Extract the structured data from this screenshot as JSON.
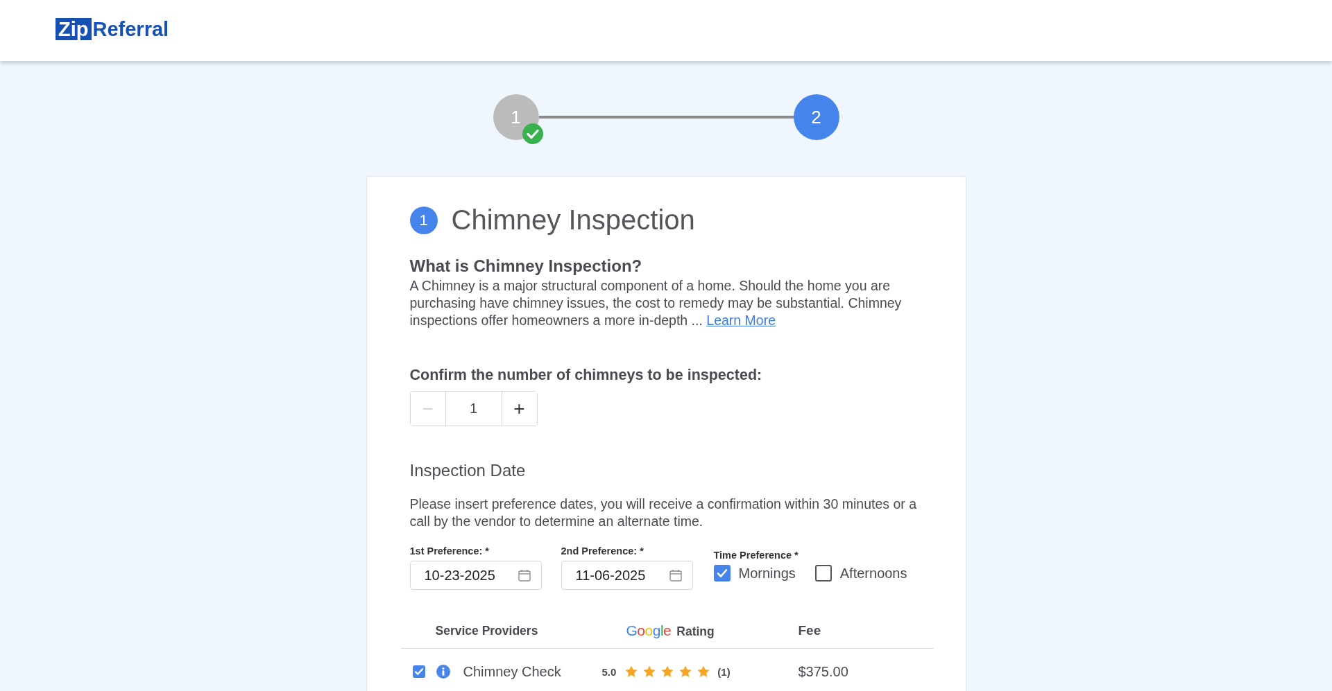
{
  "logo": {
    "boxed": "Zip",
    "text": "Referral"
  },
  "stepper": [
    {
      "label": "1",
      "done": true,
      "selected": false
    },
    {
      "label": "2",
      "done": false,
      "selected": true
    }
  ],
  "card": {
    "step": "1",
    "title": "Chimney Inspection",
    "subtitle": "What is Chimney Inspection?",
    "description": "A Chimney is a major structural component of a home. Should the home you are purchasing have chimney issues, the cost to remedy may be substantial. Chimney inspections offer homeowners a more in-depth ...",
    "link": "Learn More",
    "count_label": "Confirm the number of chimneys to be inspected:",
    "counter": {
      "minus": "−",
      "value": "1",
      "plus": "+",
      "minus_disabled": true
    },
    "date_heading": "Inspection Date",
    "date_text": "Please insert preference dates, you will receive a confirmation within 30 minutes or a call by the vendor to determine an alternate time.",
    "dates": [
      {
        "label": "1st Preference: *",
        "value": "10-23-2025"
      },
      {
        "label": "2nd Preference: *",
        "value": "11-06-2025"
      }
    ],
    "time_label": "Time Preference *",
    "times": [
      {
        "label": "Mornings",
        "checked": true
      },
      {
        "label": "Afternoons",
        "checked": false
      }
    ],
    "table": {
      "columns": [
        "Service Providers",
        {
          "brand": "Google",
          "label": "Rating"
        },
        "Fee"
      ],
      "rows": [
        {
          "checked": true,
          "name": "Chimney Check",
          "rating": "5.0",
          "stars": 5,
          "reviews": "(1)",
          "fee": "$375.00"
        }
      ]
    }
  }
}
